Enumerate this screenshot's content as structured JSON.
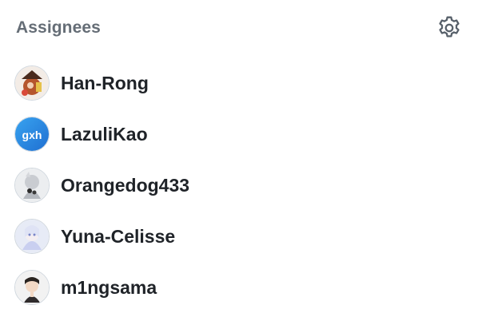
{
  "section": {
    "title": "Assignees",
    "settings_icon": "gear-icon"
  },
  "assignees": [
    {
      "name": "Han-Rong"
    },
    {
      "name": "LazuliKao",
      "avatar_text": "gxh"
    },
    {
      "name": "Orangedog433"
    },
    {
      "name": "Yuna-Celisse"
    },
    {
      "name": "m1ngsama"
    }
  ],
  "colors": {
    "title": "#656d76",
    "name": "#1f2328",
    "avatar_border": "#d0d7de"
  }
}
